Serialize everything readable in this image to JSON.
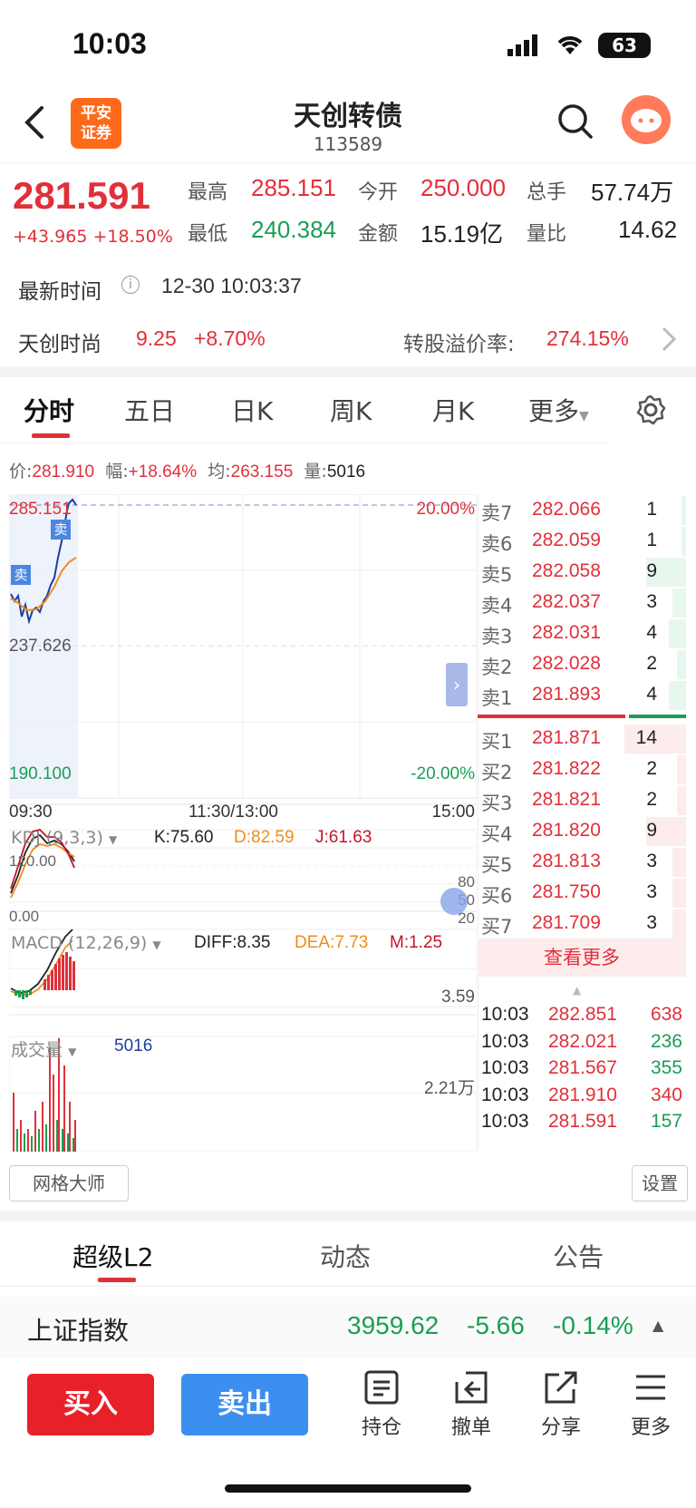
{
  "status_bar": {
    "time": "10:03",
    "battery": "63"
  },
  "header": {
    "logo_line1": "平安",
    "logo_line2": "证券",
    "title": "天创转债",
    "code": "113589"
  },
  "quote": {
    "price": "281.591",
    "change": "+43.965",
    "change_pct": "+18.50%",
    "high_label": "最高",
    "high": "285.151",
    "open_label": "今开",
    "open": "250.000",
    "volume_label": "总手",
    "volume": "57.74万",
    "low_label": "最低",
    "low": "240.384",
    "amount_label": "金额",
    "amount": "15.19亿",
    "ratio_label": "量比",
    "ratio": "14.62",
    "latest_time_label": "最新时间",
    "latest_time": "12-30 10:03:37",
    "underlying_name": "天创时尚",
    "underlying_price": "9.25",
    "underlying_pct": "+8.70%",
    "premium_label": "转股溢价率:",
    "premium": "274.15%"
  },
  "chart_tabs": [
    "分时",
    "五日",
    "日K",
    "周K",
    "月K",
    "更多"
  ],
  "info_line": {
    "price_label": "价:",
    "price": "281.910",
    "amp_label": "幅:",
    "amp": "+18.64%",
    "avg_label": "均:",
    "avg": "263.155",
    "vol_label": "量:",
    "vol": "5016"
  },
  "intraday": {
    "y_top": "285.151",
    "y_mid": "237.626",
    "y_bot": "190.100",
    "pct_top": "20.00%",
    "pct_bot": "-20.00%",
    "x_start": "09:30",
    "x_mid": "11:30/13:00",
    "x_end": "15:00",
    "sell_marker": "卖"
  },
  "kdj": {
    "title": "KDJ (9,3,3)",
    "k": "K:75.60",
    "d": "D:82.59",
    "j": "J:61.63",
    "y_top": "120.00",
    "y_bot": "0.00",
    "r80": "80",
    "r50": "50",
    "r20": "20"
  },
  "macd": {
    "title": "MACD (12,26,9)",
    "diff": "DIFF:8.35",
    "dea": "DEA:7.73",
    "m": "M:1.25",
    "y": "3.59"
  },
  "volume": {
    "title": "成交量",
    "value": "5016",
    "y": "2.21万"
  },
  "order_book": {
    "asks": [
      {
        "label": "卖7",
        "price": "282.066",
        "vol": "1"
      },
      {
        "label": "卖6",
        "price": "282.059",
        "vol": "1"
      },
      {
        "label": "卖5",
        "price": "282.058",
        "vol": "9"
      },
      {
        "label": "卖4",
        "price": "282.037",
        "vol": "3"
      },
      {
        "label": "卖3",
        "price": "282.031",
        "vol": "4"
      },
      {
        "label": "卖2",
        "price": "282.028",
        "vol": "2"
      },
      {
        "label": "卖1",
        "price": "281.893",
        "vol": "4"
      }
    ],
    "bids": [
      {
        "label": "买1",
        "price": "281.871",
        "vol": "14"
      },
      {
        "label": "买2",
        "price": "281.822",
        "vol": "2"
      },
      {
        "label": "买3",
        "price": "281.821",
        "vol": "2"
      },
      {
        "label": "买4",
        "price": "281.820",
        "vol": "9"
      },
      {
        "label": "买5",
        "price": "281.813",
        "vol": "3"
      },
      {
        "label": "买6",
        "price": "281.750",
        "vol": "3"
      },
      {
        "label": "买7",
        "price": "281.709",
        "vol": "3"
      }
    ],
    "more_label": "查看更多"
  },
  "trades": [
    {
      "time": "10:03",
      "price": "282.851",
      "vol": "638",
      "side": "red"
    },
    {
      "time": "10:03",
      "price": "282.021",
      "vol": "236",
      "side": "green"
    },
    {
      "time": "10:03",
      "price": "281.567",
      "vol": "355",
      "side": "green"
    },
    {
      "time": "10:03",
      "price": "281.910",
      "vol": "340",
      "side": "red"
    },
    {
      "time": "10:03",
      "price": "281.591",
      "vol": "157",
      "side": "green"
    }
  ],
  "tools": {
    "grid_master": "网格大师",
    "settings": "设置"
  },
  "bottom_tabs": [
    "超级L2",
    "动态",
    "公告"
  ],
  "index": {
    "name": "上证指数",
    "value": "3959.62",
    "change": "-5.66",
    "pct": "-0.14%"
  },
  "actions": {
    "buy": "买入",
    "sell": "卖出",
    "position": "持仓",
    "cancel": "撤单",
    "share": "分享",
    "more": "更多"
  },
  "colors": {
    "up": "#e0303a",
    "down": "#1a9e55",
    "buy_button": "#e8202a",
    "sell_button": "#3d8fef",
    "brand": "#ff6a1a"
  }
}
